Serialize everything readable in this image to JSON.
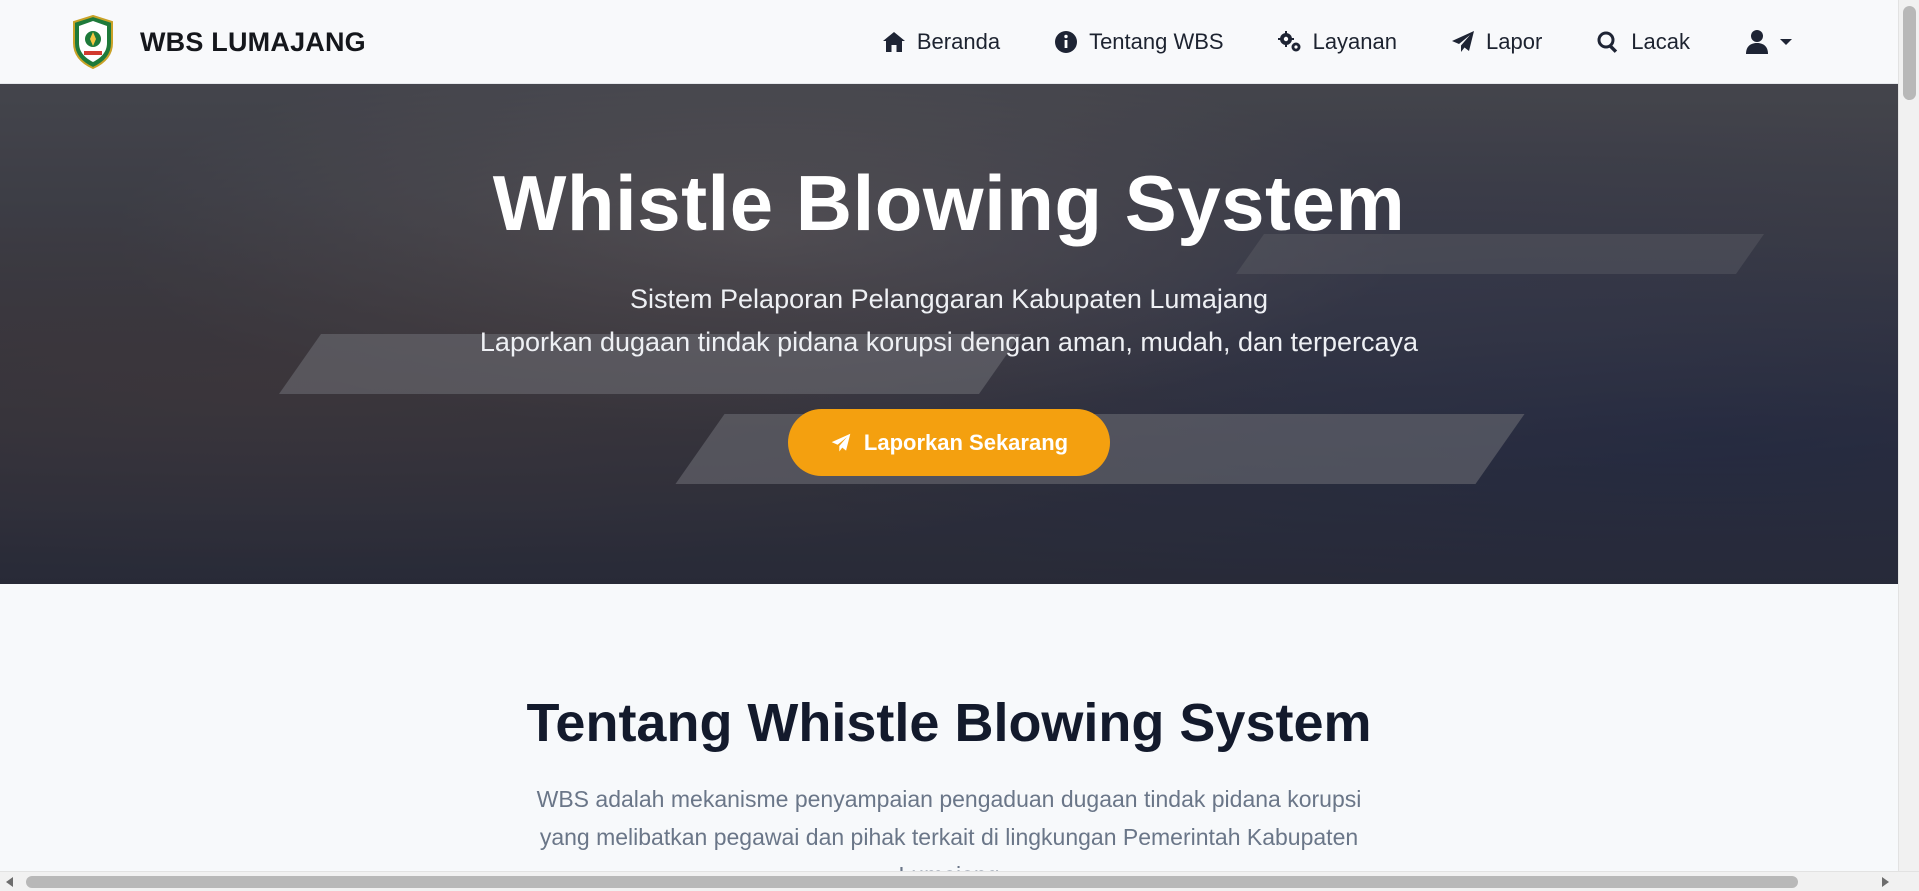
{
  "brand": {
    "name": "WBS LUMAJANG",
    "logo_icon": "lumajang-crest-logo"
  },
  "nav": {
    "items": [
      {
        "label": "Beranda",
        "icon": "home-icon"
      },
      {
        "label": "Tentang WBS",
        "icon": "info-icon"
      },
      {
        "label": "Layanan",
        "icon": "gears-icon"
      },
      {
        "label": "Lapor",
        "icon": "paper-plane-icon"
      },
      {
        "label": "Lacak",
        "icon": "search-icon"
      }
    ],
    "user_icon": "user-icon",
    "dropdown_icon": "caret-down-icon"
  },
  "hero": {
    "title": "Whistle Blowing System",
    "subtitle_line1": "Sistem Pelaporan Pelanggaran Kabupaten Lumajang",
    "subtitle_line2": "Laporkan dugaan tindak pidana korupsi dengan aman, mudah, dan terpercaya",
    "cta_label": "Laporkan Sekarang",
    "cta_icon": "paper-plane-icon",
    "cta_color": "#f4a00f"
  },
  "about": {
    "title": "Tentang Whistle Blowing System",
    "text": "WBS adalah mekanisme penyampaian pengaduan dugaan tindak pidana korupsi yang melibatkan pegawai dan pihak terkait di lingkungan Pemerintah Kabupaten Lumajang"
  },
  "colors": {
    "accent": "#f4a00f",
    "navy": "#131a2c",
    "text_muted": "#6a7688"
  }
}
